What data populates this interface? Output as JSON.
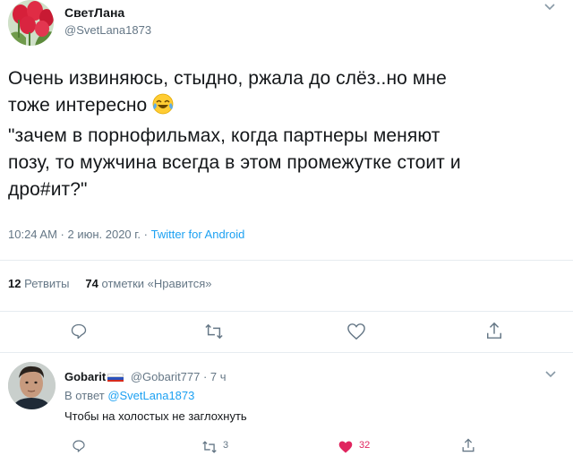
{
  "tweet": {
    "author_name": "СветЛана",
    "author_handle": "@SvetLana1873",
    "text_lines": [
      "Очень извиняюсь, стыдно, ржала до слёз..но мне",
      "тоже интересно",
      "\"зачем в порнофильмах, когда партнеры меняют",
      "позу, то мужчина всегда в этом промежутке стоит и",
      "дро#ит?\""
    ],
    "emoji": "face-with-tears-of-joy",
    "timestamp": "10:24 AM · 2 июн. 2020 г. · ",
    "source": "Twitter for Android",
    "retweets_count": "12",
    "retweets_label": "Ретвиты",
    "likes_count": "74",
    "likes_label": "отметки «Нравится»"
  },
  "reply": {
    "author_name": "Gobarit",
    "author_handle": "@Gobarit777 · 7 ч",
    "reply_prefix": "В ответ ",
    "reply_to": "@SvetLana1873",
    "text": "Чтобы на холостых не заглохнуть",
    "retweet_count": "3",
    "like_count": "32"
  },
  "colors": {
    "accent": "#1da1f2",
    "secondary_text": "#657786",
    "like_red": "#e0245e",
    "divider": "#e6ecf0"
  }
}
